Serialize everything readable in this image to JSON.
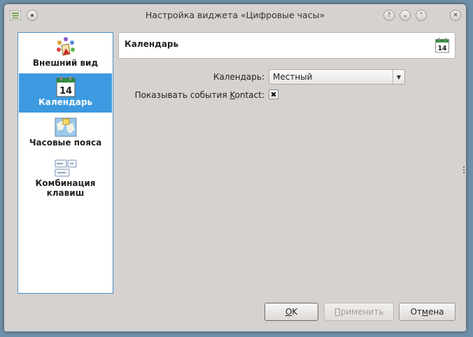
{
  "window": {
    "title": "Настройка виджета «Цифровые часы»"
  },
  "sidebar": {
    "items": [
      {
        "label": "Внешний вид",
        "icon": "appearance-icon"
      },
      {
        "label": "Календарь",
        "icon": "calendar-icon",
        "selected": true
      },
      {
        "label": "Часовые пояса",
        "icon": "timezones-map-icon"
      },
      {
        "label": "Комбинация клавиш",
        "icon": "keyboard-shortcut-icon"
      }
    ]
  },
  "header": {
    "title": "Календарь",
    "icon_number": "14"
  },
  "form": {
    "calendar_label": "Календарь:",
    "calendar_value": "Местный",
    "show_events_pre": "Показывать события ",
    "show_events_accel": "K",
    "show_events_post": "ontact:",
    "show_events_checked": true
  },
  "buttons": {
    "ok_accel": "O",
    "ok_rest": "K",
    "apply_accel": "П",
    "apply_rest": "рименить",
    "cancel_pre": "От",
    "cancel_accel": "м",
    "cancel_post": "ена"
  },
  "colors": {
    "selection": "#3d9ae0",
    "sidebar_border": "#4a90c8",
    "window_bg": "#d6d2d0"
  }
}
